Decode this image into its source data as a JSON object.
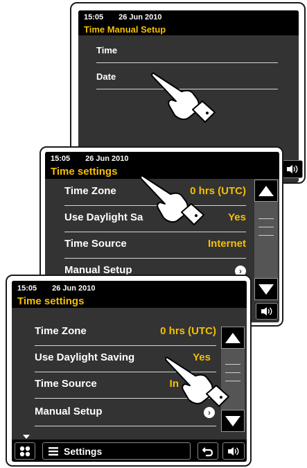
{
  "screen_back": {
    "status_time": "15:05",
    "status_date": "26 Jun 2010",
    "title": "Time Manual Setup",
    "items": [
      {
        "label": "Time"
      },
      {
        "label": "Date"
      }
    ]
  },
  "screen_middle": {
    "status_time": "15:05",
    "status_date": "26 Jun 2010",
    "title": "Time settings",
    "items": [
      {
        "label": "Time Zone",
        "value": "0 hrs (UTC)"
      },
      {
        "label": "Use Daylight Saving",
        "value": "Yes",
        "visible_label": "Use Daylight Sa"
      },
      {
        "label": "Time Source",
        "value": "Internet"
      },
      {
        "label": "Manual Setup"
      }
    ]
  },
  "screen_front": {
    "status_time": "15:05",
    "status_date": "26 Jun 2010",
    "title": "Time settings",
    "items": [
      {
        "label": "Time Zone",
        "value": "0 hrs (UTC)"
      },
      {
        "label": "Use Daylight Saving",
        "value": "Yes"
      },
      {
        "label": "Time Source",
        "value": "In"
      },
      {
        "label": "Manual Setup"
      }
    ],
    "bottom_bar": {
      "menu_label": "Settings"
    }
  },
  "colors": {
    "screen_bg": "#333333",
    "header_bg": "#000000",
    "accent": "#f5c000",
    "text": "#ffffff"
  },
  "icons": [
    "pointing-hand-icon",
    "scroll-up-icon",
    "scroll-down-icon",
    "chevron-right-icon",
    "home-grid-icon",
    "menu-lines-icon",
    "back-arrow-icon",
    "volume-icon"
  ]
}
